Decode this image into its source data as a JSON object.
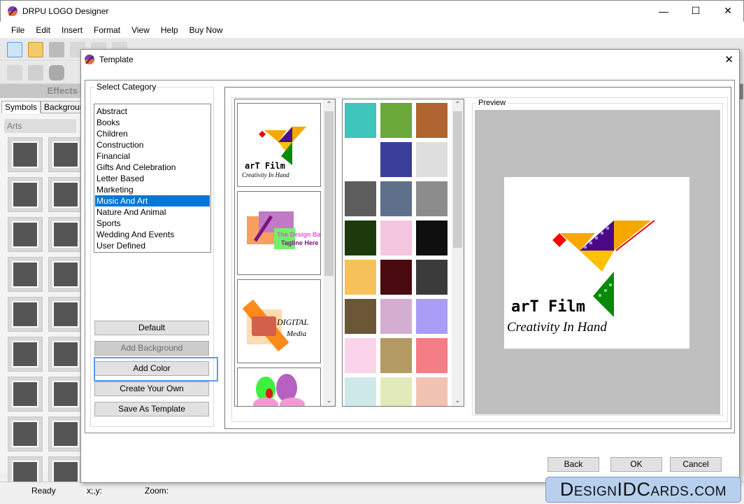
{
  "app": {
    "title": "DRPU LOGO Designer"
  },
  "window_controls": {
    "minimize": "—",
    "maximize": "☐",
    "close": "✕"
  },
  "menu": [
    "File",
    "Edit",
    "Insert",
    "Format",
    "View",
    "Help",
    "Buy Now"
  ],
  "sidebar": {
    "header": "Effects",
    "tabs": [
      "Symbols",
      "Backgroun"
    ],
    "section": "Arts",
    "symbol_count": 18
  },
  "status": {
    "ready": "Ready",
    "xy": "x;,y:",
    "zoom": "Zoom:"
  },
  "dialog": {
    "title": "Template",
    "close": "✕",
    "category_legend": "Select Category",
    "categories": [
      "Abstract",
      "Books",
      "Children",
      "Construction",
      "Financial",
      "Gifts And Celebration",
      "Letter Based",
      "Marketing",
      "Music And Art",
      "Nature And Animal",
      "Sports",
      "Wedding And Events",
      "User Defined"
    ],
    "selected_category": "Music And Art",
    "buttons": {
      "default": "Default",
      "add_background": "Add Background",
      "add_color": "Add Color",
      "create_your_own": "Create Your Own",
      "save_as_template": "Save As Template"
    },
    "templates": [
      {
        "name": "arT Film",
        "tagline": "Creativity In Hand"
      },
      {
        "name": "The Design Bag",
        "tagline": "Tagline Here"
      },
      {
        "name": "DIGITAL",
        "tagline": "Media"
      },
      {
        "name": "flower-logo",
        "tagline": ""
      }
    ],
    "backgrounds": [
      "#3fc4bb",
      "#6aa83a",
      "#b0642f",
      "#ffffff",
      "#3b3e9a",
      "#dedede",
      "#5d5d5d",
      "#5f708a",
      "#8c8c8c",
      "#1d3a0c",
      "#f4c6df",
      "#0f0f0f",
      "#f6c05a",
      "#4a0a10",
      "#3b3b3b",
      "#6b5738",
      "#d4aed0",
      "#a99cf6",
      "#fbd3ea",
      "#b39a63",
      "#f47d86",
      "#cfe9ea",
      "#e2eab9",
      "#f1c3b2"
    ],
    "preview_legend": "Preview",
    "preview": {
      "name": "arT Film",
      "tagline": "Creativity In Hand"
    },
    "footer": {
      "back": "Back",
      "ok": "OK",
      "cancel": "Cancel"
    }
  },
  "watermark": "DesignIDCards.com"
}
